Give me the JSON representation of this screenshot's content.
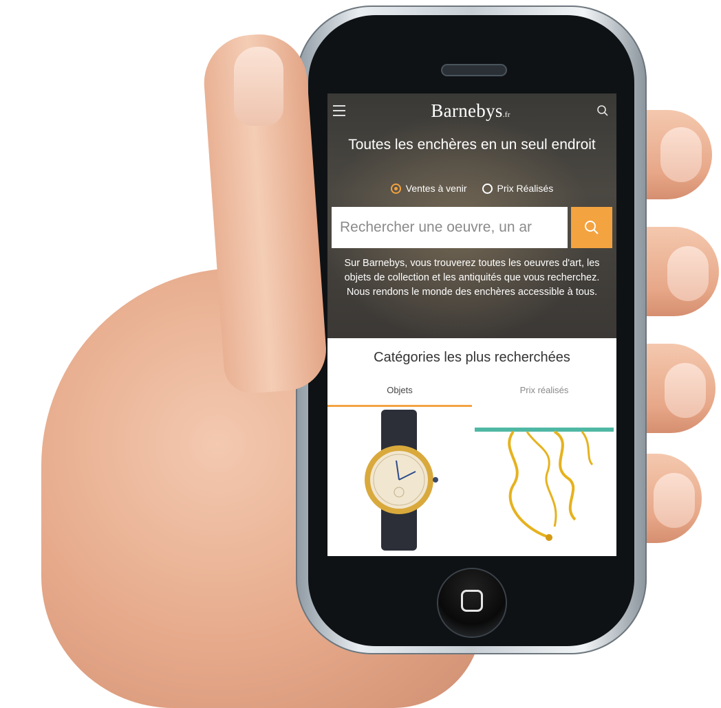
{
  "app": {
    "brand_name": "Barnebys",
    "brand_suffix": ".fr",
    "menu_icon": "hamburger-menu-icon",
    "search_icon": "search-icon"
  },
  "hero": {
    "headline": "Toutes les enchères en un seul endroit",
    "radio_options": [
      {
        "label": "Ventes à venir",
        "selected": true
      },
      {
        "label": "Prix Réalisés",
        "selected": false
      }
    ],
    "search_placeholder": "Rechercher une oeuvre, un ar",
    "description": "Sur Barnebys, vous trouverez toutes les oeuvres d'art, les objets de collection et les antiquités que vous recherchez. Nous rendons le monde des enchères accessible à tous."
  },
  "categories": {
    "title": "Catégories les plus recherchées",
    "tabs": [
      {
        "label": "Objets",
        "active": true
      },
      {
        "label": "Prix réalisés",
        "active": false
      }
    ],
    "items": [
      {
        "icon": "wristwatch-icon"
      },
      {
        "icon": "console-table-icon"
      }
    ]
  },
  "colors": {
    "accent": "#f3a340",
    "hero_bg": "#3f3d39",
    "text_dark": "#333333"
  }
}
